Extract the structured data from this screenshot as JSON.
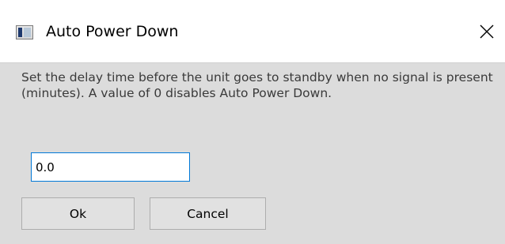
{
  "window": {
    "title": "Auto Power Down",
    "app_icon": "window-app-icon",
    "close_icon": "close-icon"
  },
  "dialog": {
    "message": "Set the delay time before the unit goes to standby when no signal is present (minutes). A value of 0 disables Auto Power Down.",
    "delay_value": "0.0",
    "ok_label": "Ok",
    "cancel_label": "Cancel"
  },
  "colors": {
    "titlebar_bg": "#ffffff",
    "dialog_bg": "#dcdcdc",
    "input_focus_border": "#0078d7",
    "button_bg": "#e1e1e1"
  }
}
